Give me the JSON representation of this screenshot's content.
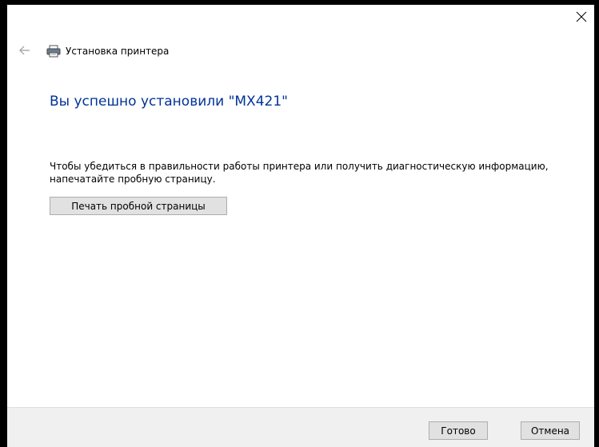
{
  "window": {
    "close_symbol": "×",
    "back_symbol": "←",
    "title": "Установка принтера"
  },
  "main": {
    "heading": "Вы успешно установили \"MX421\"",
    "description": "Чтобы убедиться в правильности работы принтера или получить диагностическую информацию, напечатайте пробную страницу.",
    "print_test_page_label": "Печать пробной страницы"
  },
  "footer": {
    "finish_label": "Готово",
    "cancel_label": "Отмена"
  },
  "icons": {
    "close": "close-icon",
    "back": "back-arrow-icon",
    "printer": "printer-icon"
  },
  "colors": {
    "heading": "#003399",
    "footer_bg": "#f0f0f0",
    "button_bg": "#e1e1e1",
    "button_border": "#adadad"
  }
}
